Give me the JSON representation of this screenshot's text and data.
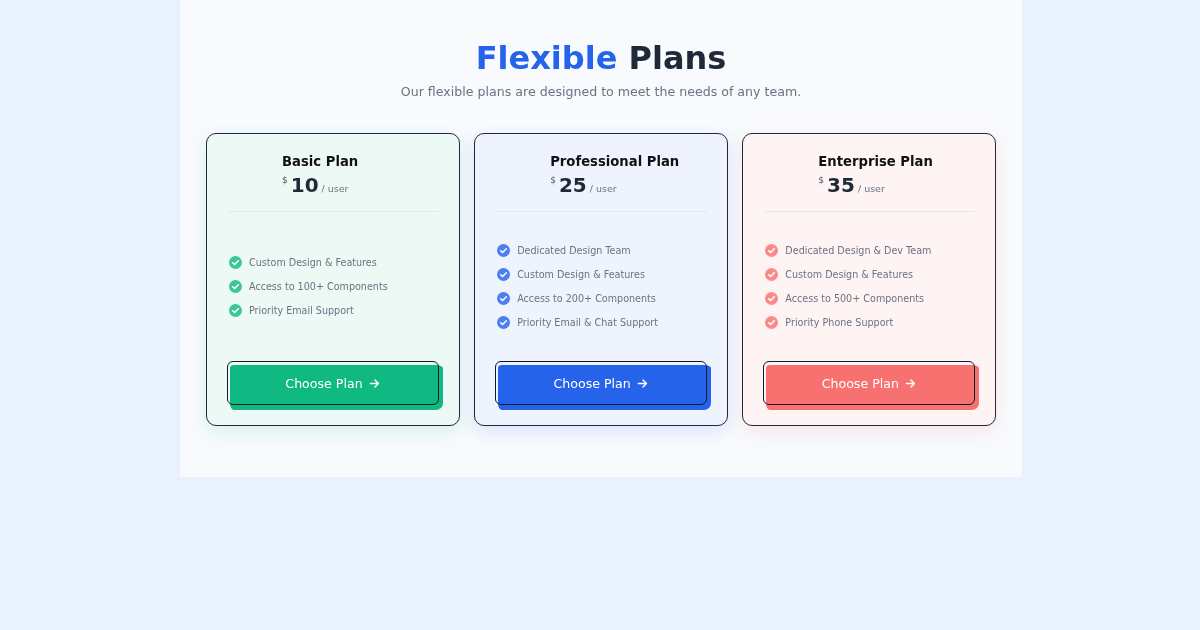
{
  "header": {
    "title": {
      "accent": "Flexible",
      "rest": "Plans"
    },
    "subtitle": "Our flexible plans are designed to meet the needs of any team."
  },
  "plans": [
    {
      "name": "Basic Plan",
      "currency": "$",
      "price": "10",
      "period": "/ user",
      "color": "#10b981",
      "features": [
        "Custom Design & Features",
        "Access to 100+ Components",
        "Priority Email Support"
      ],
      "button": "Choose Plan"
    },
    {
      "name": "Professional Plan",
      "currency": "$",
      "price": "25",
      "period": "/ user",
      "color": "#2563eb",
      "features": [
        "Dedicated Design Team",
        "Custom Design & Features",
        "Access to 200+ Components",
        "Priority Email & Chat Support"
      ],
      "button": "Choose Plan"
    },
    {
      "name": "Enterprise Plan",
      "currency": "$",
      "price": "35",
      "period": "/ user",
      "color": "#f87171",
      "features": [
        "Dedicated Design & Dev Team",
        "Custom Design & Features",
        "Access to 500+ Components",
        "Priority Phone Support"
      ],
      "button": "Choose Plan"
    }
  ]
}
